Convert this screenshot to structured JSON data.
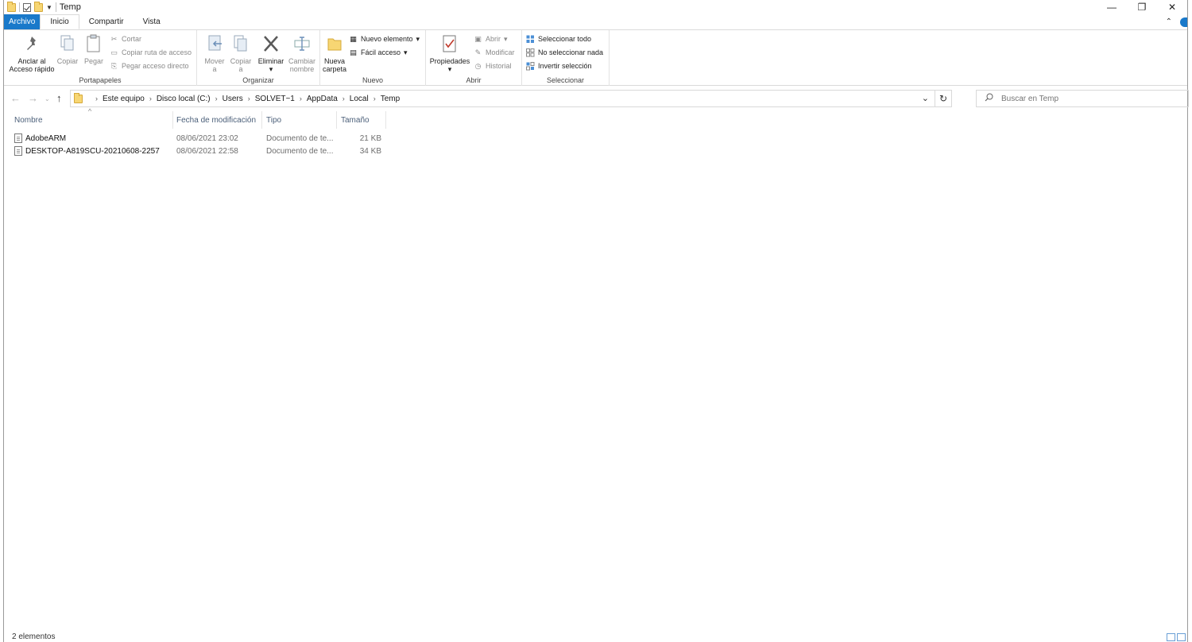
{
  "window": {
    "title": "Temp",
    "controls": {
      "minimize": "—",
      "maximize": "❐",
      "close": "✕"
    }
  },
  "ribbon_tabs": [
    "Archivo",
    "Inicio",
    "Compartir",
    "Vista"
  ],
  "ribbon": {
    "portapapeles": {
      "label": "Portapapeles",
      "pin_label_1": "Anclar al",
      "pin_label_2": "Acceso rápido",
      "copy_label": "Copiar",
      "paste_label": "Pegar",
      "cut_label": "Cortar",
      "copy_path_label": "Copiar ruta de acceso",
      "paste_shortcut_label": "Pegar acceso directo"
    },
    "organizar": {
      "label": "Organizar",
      "move_label_1": "Mover",
      "move_label_2": "a",
      "copyto_label_1": "Copiar",
      "copyto_label_2": "a",
      "delete_label": "Eliminar",
      "rename_label_1": "Cambiar",
      "rename_label_2": "nombre"
    },
    "nuevo": {
      "label": "Nuevo",
      "new_folder_1": "Nueva",
      "new_folder_2": "carpeta",
      "new_item": "Nuevo elemento",
      "easy_access": "Fácil acceso"
    },
    "abrir": {
      "label": "Abrir",
      "properties": "Propiedades",
      "open": "Abrir",
      "edit": "Modificar",
      "history": "Historial"
    },
    "seleccionar": {
      "label": "Seleccionar",
      "select_all": "Seleccionar todo",
      "select_none": "No seleccionar nada",
      "invert": "Invertir selección"
    }
  },
  "address": {
    "crumbs": [
      "Este equipo",
      "Disco local (C:)",
      "Users",
      "SOLVET~1",
      "AppData",
      "Local",
      "Temp"
    ]
  },
  "search": {
    "placeholder": "Buscar en Temp"
  },
  "columns": {
    "name": "Nombre",
    "date": "Fecha de modificación",
    "type": "Tipo",
    "size": "Tamaño"
  },
  "files": [
    {
      "name": "AdobeARM",
      "date": "08/06/2021 23:02",
      "type": "Documento de te...",
      "size": "21 KB"
    },
    {
      "name": "DESKTOP-A819SCU-20210608-2257",
      "date": "08/06/2021 22:58",
      "type": "Documento de te...",
      "size": "34 KB"
    }
  ],
  "status": {
    "count": "2 elementos"
  },
  "colors": {
    "accent": "#1979ca",
    "folder": "#f7d673"
  }
}
